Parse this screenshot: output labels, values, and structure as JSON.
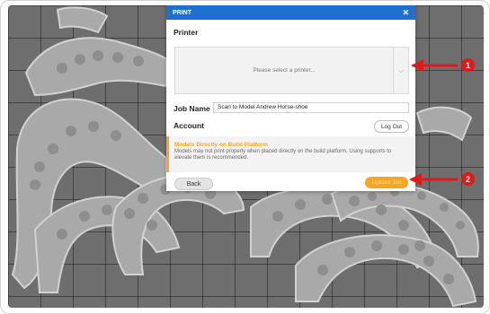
{
  "dialog": {
    "title": "PRINT",
    "close_glyph": "✕",
    "printer_section_label": "Printer",
    "printer_placeholder": "Please select a printer...",
    "printer_chevron": "⌵",
    "job_name_label": "Job Name",
    "job_name_value": "Scan to Model Andrew Horse-shoe",
    "account_label": "Account",
    "logout_label": "Log Out",
    "warning_title": "Models Directly on Build Platform",
    "warning_text": "Models may not print properly when placed directly on the build platform. Using supports to elevate them is recommended.",
    "back_label": "Back",
    "upload_label": "Upload Job"
  },
  "callouts": [
    {
      "label": "1"
    },
    {
      "label": "2"
    }
  ],
  "colors": {
    "header_blue": "#1d6fd0",
    "warning_orange": "#f5a623",
    "callout_red": "#e0191a"
  },
  "icons": {
    "close": "close-icon",
    "printer_dropdown": "chevron-down-icon"
  }
}
